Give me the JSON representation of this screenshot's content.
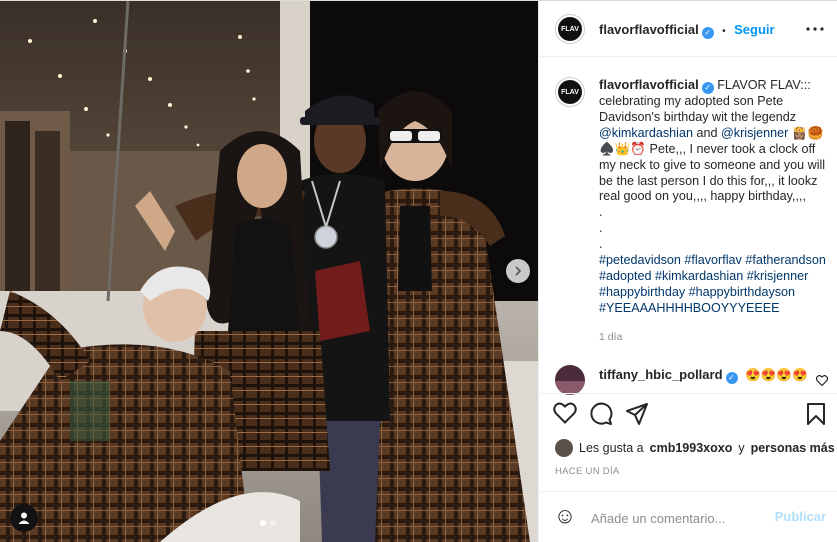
{
  "post": {
    "carousel": {
      "slide_index": 1,
      "slide_count": 2
    }
  },
  "header": {
    "username": "flavorflavofficial",
    "separator": "•",
    "follow_label": "Seguir",
    "avatar_text": "FLAV"
  },
  "caption": {
    "username": "flavorflavofficial",
    "text_1": "FLAVOR FLAV::: celebrating my adopted son Pete Davidson's birthday wit the legendz",
    "mention_1": "@kimkardashian",
    "text_and": "and",
    "mention_2": "@krisjenner",
    "emoji_1": "👸🏽🥮",
    "emoji_2": "♠️👑⏰",
    "text_2": "Pete,,, I never took a clock off my neck to give to someone and you will be the last person I do this for,,, it lookz real good on you,,,, happy birthday,,,,",
    "dots": [
      ".",
      ".",
      "."
    ],
    "hashtags": "#petedavidson #flavorflav #fatherandson #adopted #kimkardashian #krisjenner #happybirthday #happybirthdayson #YEEAAAHHHHBOOYYYEEEE",
    "time": "1 día"
  },
  "comment": {
    "username": "tiffany_hbic_pollard",
    "text": "😍😍😍😍"
  },
  "likes": {
    "prefix": "Les gusta a",
    "user": "cmb1993xoxo",
    "and": "y",
    "others": "personas más"
  },
  "timestamp": "HACE UN DÍA",
  "add_comment": {
    "placeholder": "Añade un comentario...",
    "publish_label": "Publicar",
    "emoji_icon": "☺"
  },
  "colors": {
    "link": "#00376b",
    "follow": "#0095f6",
    "verified": "#3897f0",
    "publish_disabled": "#b2dffc"
  }
}
